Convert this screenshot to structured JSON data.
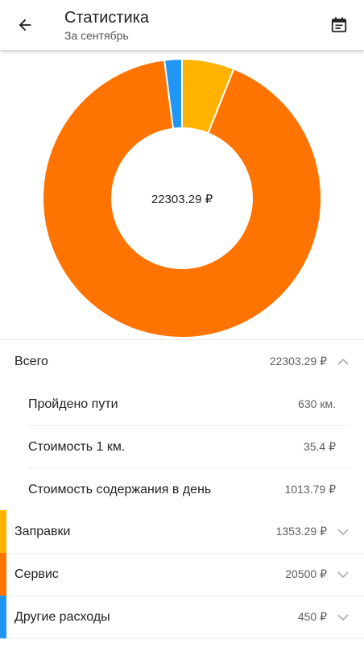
{
  "header": {
    "title": "Статистика",
    "subtitle": "За сентябрь",
    "back_icon": "arrow-back-icon",
    "calendar_icon": "calendar-icon"
  },
  "chart_data": {
    "type": "pie",
    "center_label": "22303.29 ₽",
    "categories": [
      "Заправки",
      "Сервис",
      "Другие расходы"
    ],
    "values": [
      1353.29,
      20500,
      450
    ],
    "colors": [
      "#ffb300",
      "#ff7400",
      "#2196f3"
    ]
  },
  "summary": {
    "total_label": "Всего",
    "total_value": "22303.29 ₽",
    "distance_label": "Пройдено пути",
    "distance_value": "630 км.",
    "cost_km_label": "Стоимость 1 км.",
    "cost_km_value": "35.4 ₽",
    "daily_label": "Стоимость содержания в день",
    "daily_value": "1013.79 ₽"
  },
  "categories": [
    {
      "label": "Заправки",
      "value": "1353.29 ₽",
      "color": "#ffb300"
    },
    {
      "label": "Сервис",
      "value": "20500 ₽",
      "color": "#ff7400"
    },
    {
      "label": "Другие расходы",
      "value": "450 ₽",
      "color": "#2196f3"
    }
  ]
}
